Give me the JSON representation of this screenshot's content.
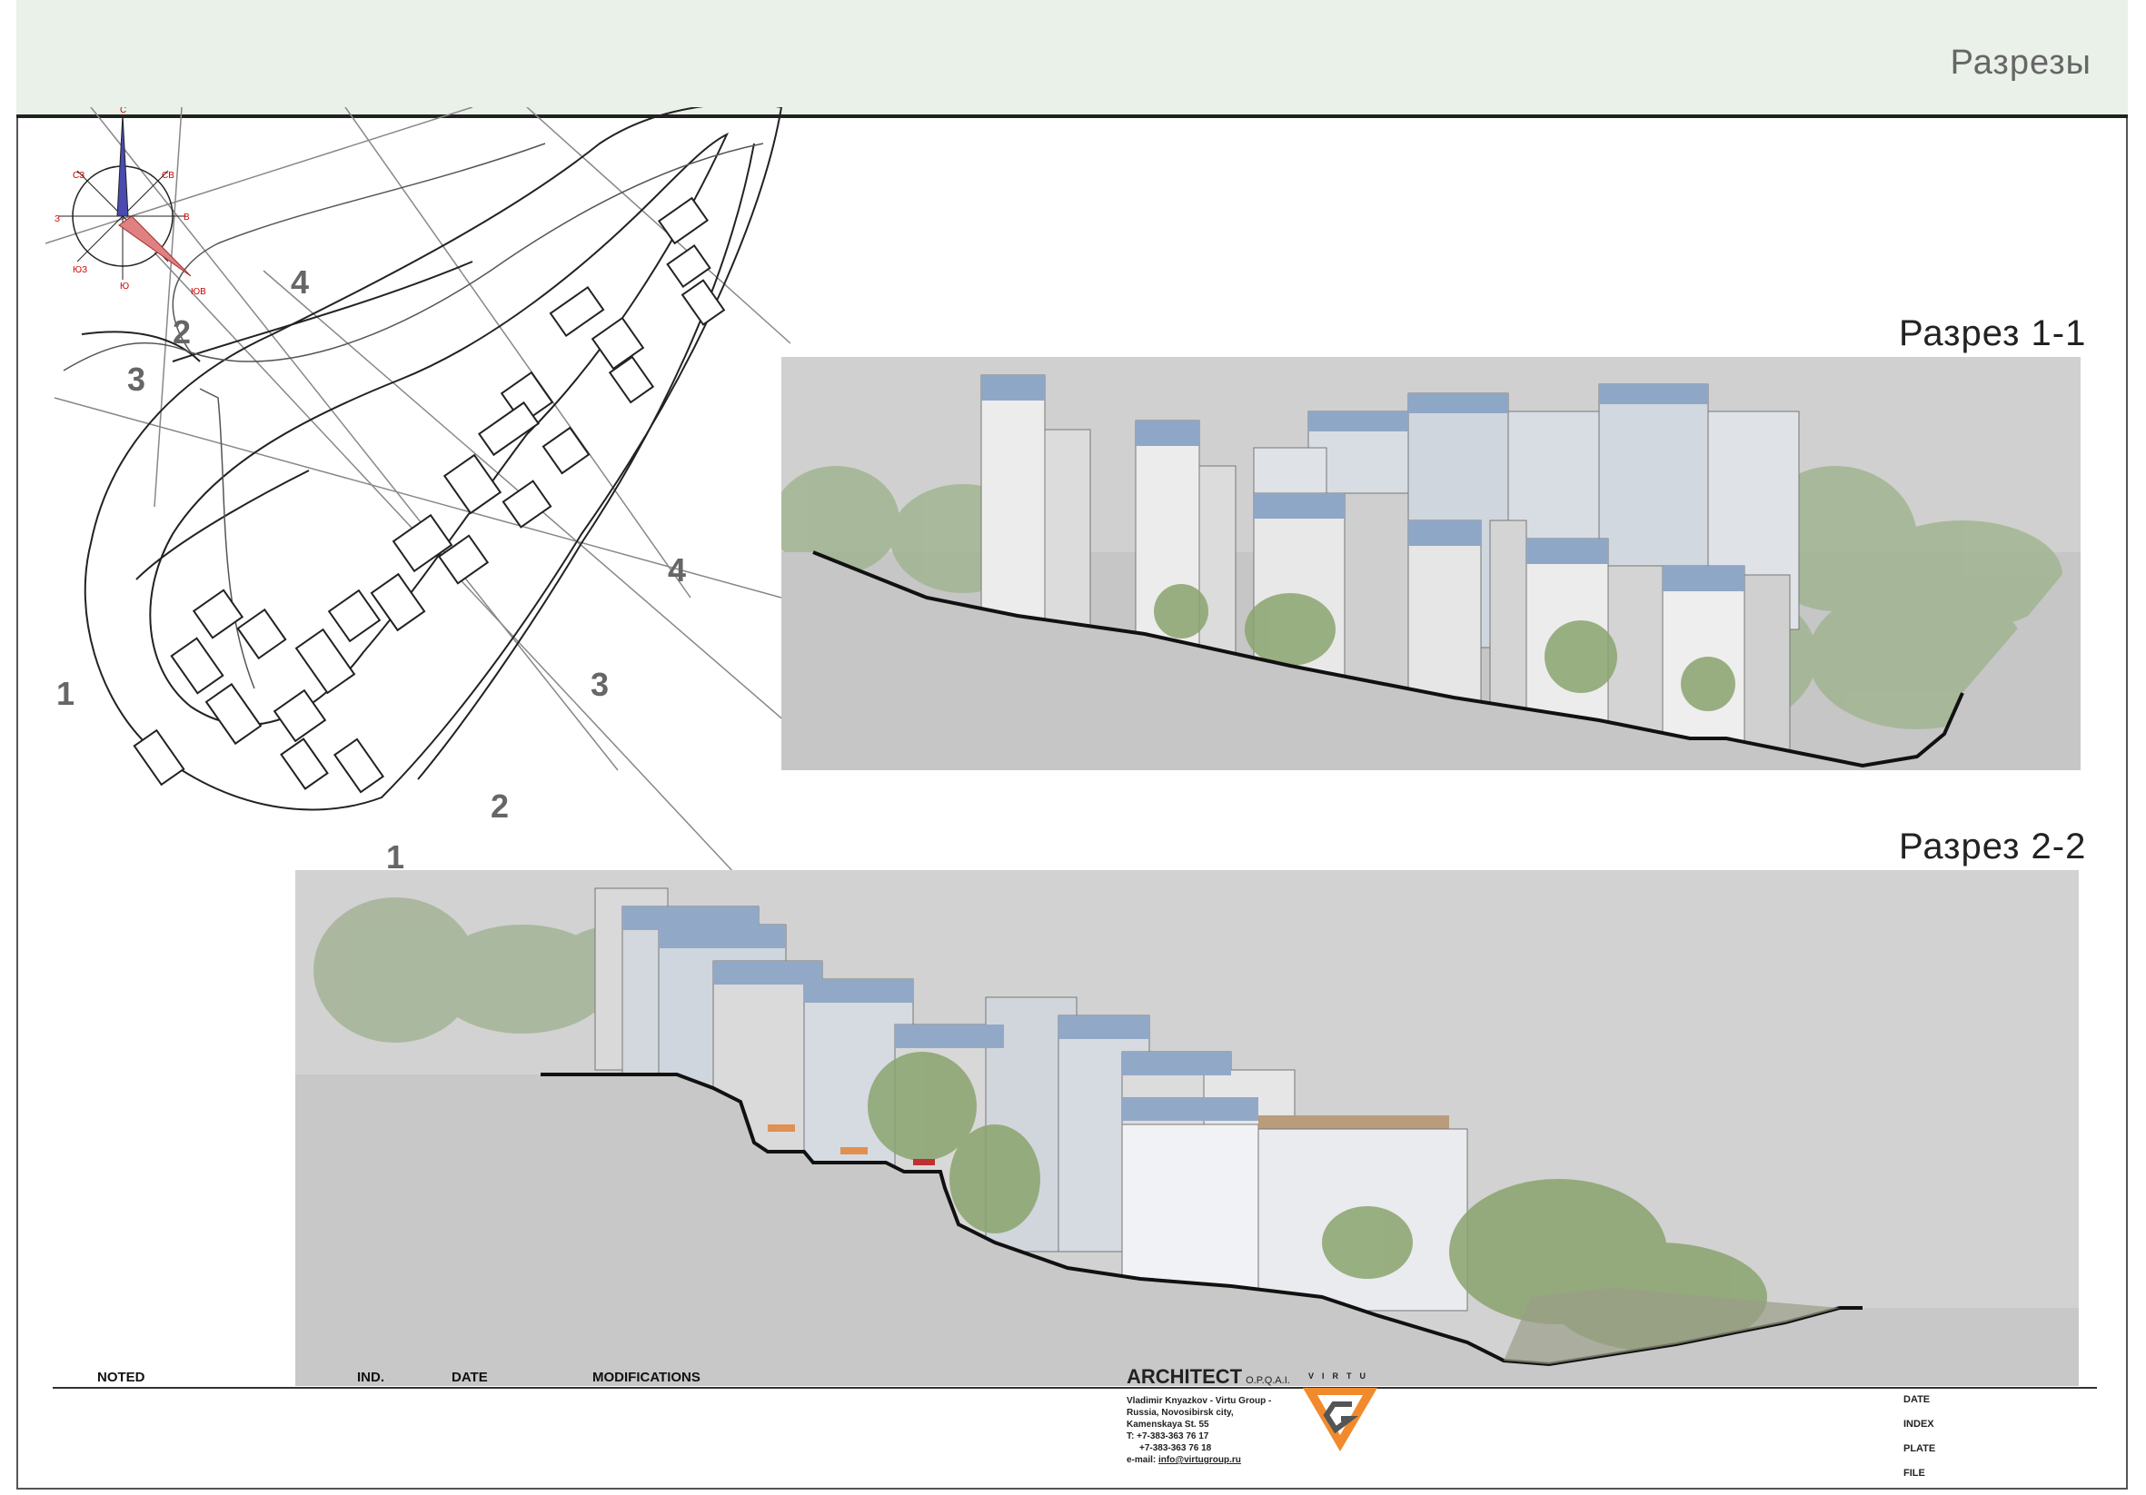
{
  "header": {
    "title": "Разрезы"
  },
  "compass": {
    "n": "С",
    "ne": "СВ",
    "e": "В",
    "se": "ЮВ",
    "s": "Ю",
    "sw": "ЮЗ",
    "w": "З",
    "nw": "СЗ"
  },
  "site_plan": {
    "labels": [
      "4",
      "2",
      "3",
      "1",
      "4",
      "3",
      "2",
      "1"
    ]
  },
  "sections": [
    {
      "title": "Разрез 1-1"
    },
    {
      "title": "Разрез 2-2"
    }
  ],
  "title_block": {
    "noted": "NOTED",
    "ind": "IND.",
    "date": "DATE",
    "modifications": "MODIFICATIONS",
    "architect": "ARCHITECT",
    "architect_suffix": "O.P.Q.A.I.",
    "brand": "VIRTU",
    "address": [
      "Vladimir Knyazkov - Virtu Group -",
      "Russia, Novosibirsk city,",
      "Kamenskaya St. 55",
      "T: +7-383-363 76 17",
      "+7-383-363 76 18"
    ],
    "email_label": "e-mail:",
    "email": "info@virtugroup.ru",
    "fields": [
      "DATE",
      "INDEX",
      "PLATE",
      "FILE"
    ]
  }
}
